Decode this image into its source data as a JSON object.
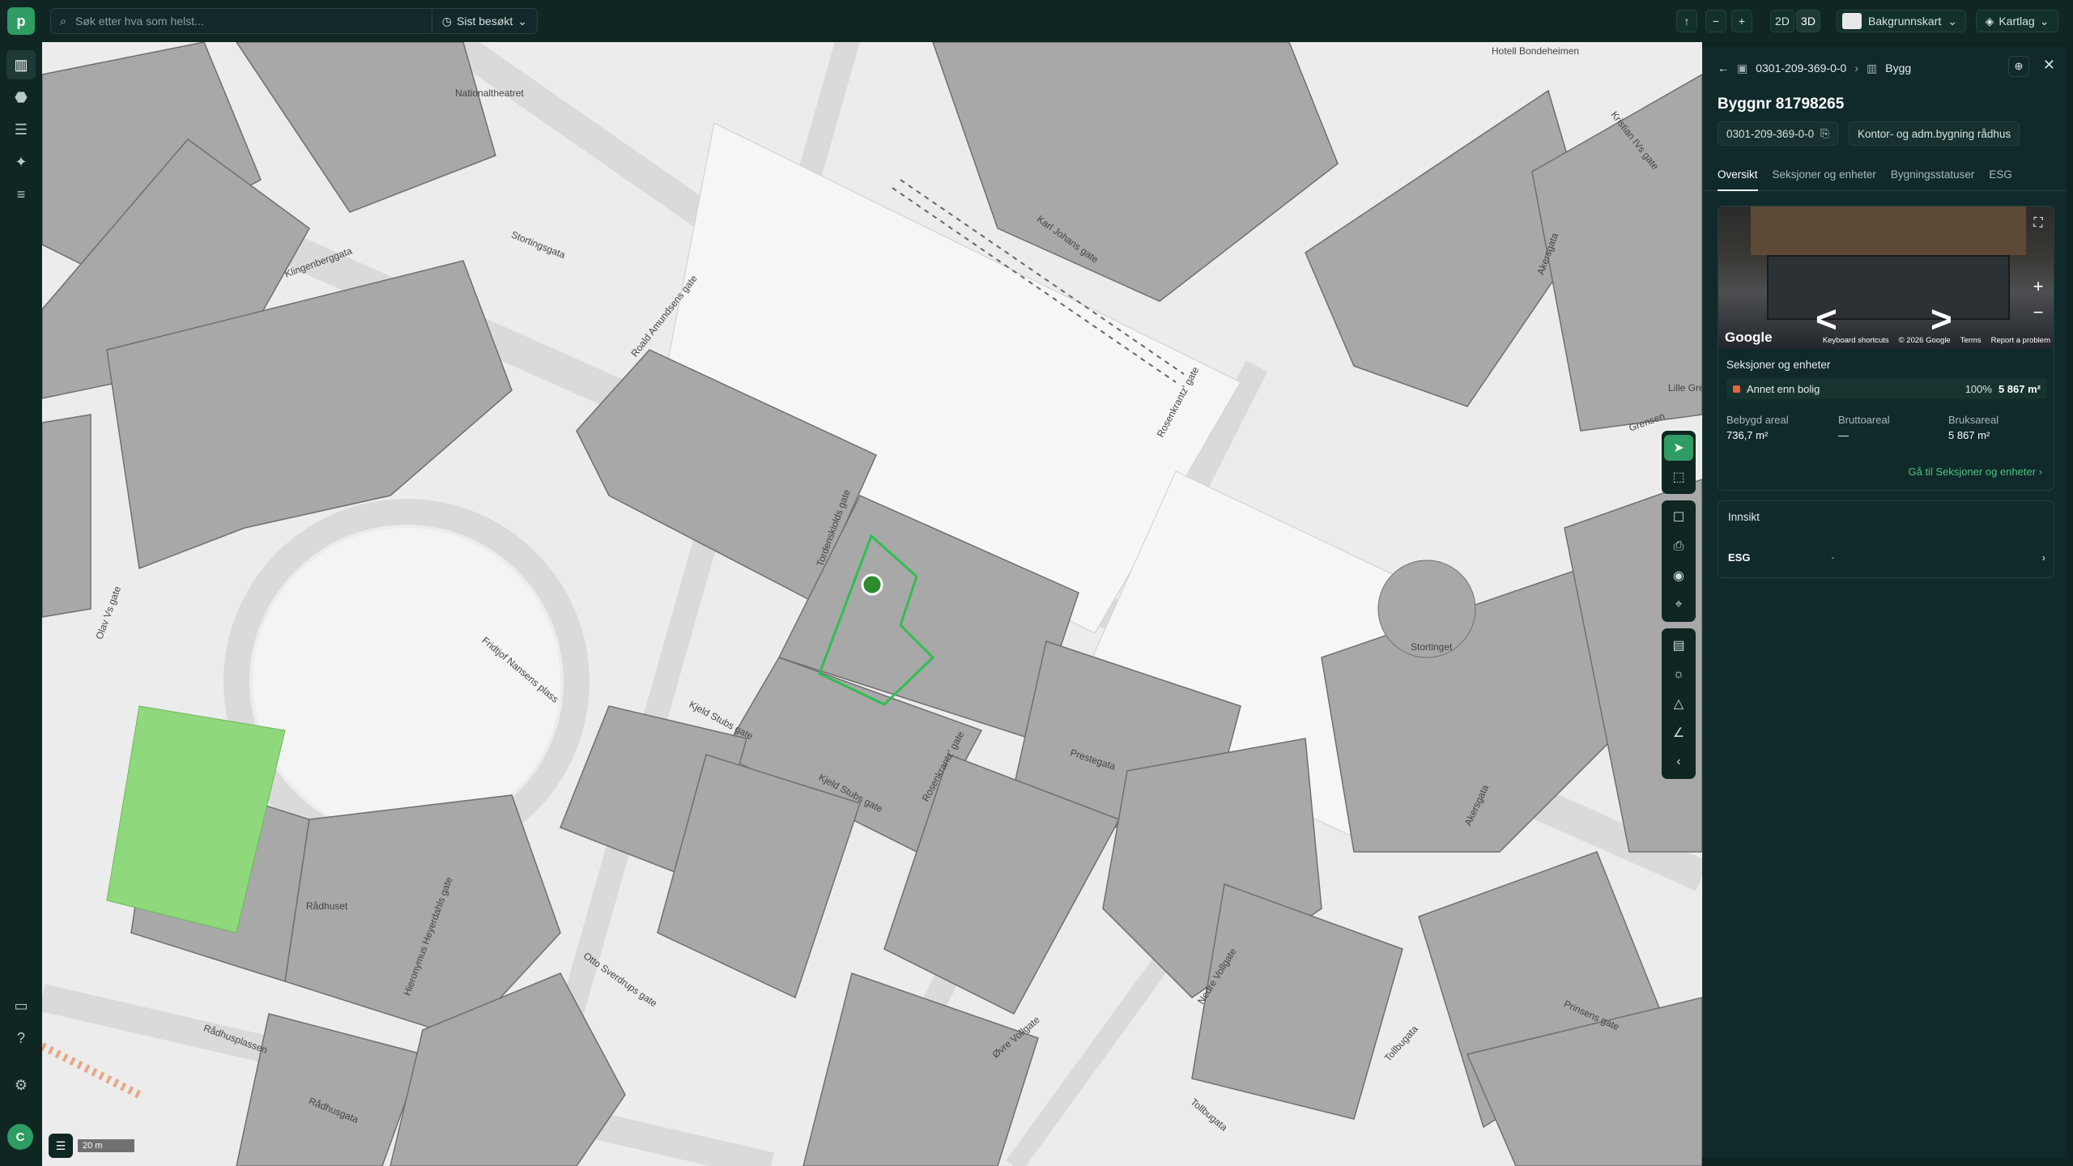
{
  "search": {
    "placeholder": "Søk etter hva som helst...",
    "recent_label": "Sist besøkt"
  },
  "toolbar": {
    "zoom_out": "−",
    "zoom_in": "+",
    "view_2d": "2D",
    "view_3d": "3D",
    "background_label": "Bakgrunnskart",
    "layers_label": "Kartlag"
  },
  "user": {
    "initial": "C"
  },
  "map": {
    "scale_label": "20 m",
    "labels": [
      "Nationaltheatret",
      "Stortingsgata",
      "Klingenberggata",
      "Roald Amundsens gate",
      "Karl Johans gate",
      "Hotell Bondeheimen",
      "Rosenkrantz' gate",
      "Tordenskiolds gate",
      "Fridtjof Nansens plass",
      "Kjeld Stubs gate",
      "Prestegata",
      "Stortinget",
      "Rådhuset",
      "Otto Sverdrups gate",
      "Rådhusplassen",
      "Hieronymus Heyerdahls gate",
      "Øvre Vollgate",
      "Nedre Vollgate",
      "Tollbugata",
      "Akersgata",
      "Olav Vs gate",
      "Lille Grensen",
      "Kristian IVs gate",
      "Akersgata",
      "Grensen",
      "Kjeld Stubs gate",
      "Rosenkrantz' gate",
      "Tollbugata",
      "Rådhusgata",
      "Prinsens gate"
    ]
  },
  "panel": {
    "breadcrumb_id": "0301-209-369-0-0",
    "breadcrumb_type": "Bygg",
    "title": "Byggnr 81798265",
    "chip_id": "0301-209-369-0-0",
    "chip_type": "Kontor- og adm.bygning rådhus",
    "tabs": [
      "Oversikt",
      "Seksjoner og enheter",
      "Bygningsstatuser",
      "ESG"
    ],
    "streetview": {
      "brand": "Google",
      "keyboard": "Keyboard shortcuts",
      "copyright": "© 2026 Google",
      "terms": "Terms",
      "report": "Report a problem"
    },
    "sections_title": "Seksjoner og enheter",
    "section_row": {
      "name": "Annet enn bolig",
      "percent": "100%",
      "area": "5 867 m²",
      "color": "#e7643c"
    },
    "stats": [
      {
        "label": "Bebygd areal",
        "value": "736,7 m²"
      },
      {
        "label": "Bruttoareal",
        "value": "—"
      },
      {
        "label": "Bruksareal",
        "value": "5 867 m²"
      }
    ],
    "goto_link": "Gå til Seksjoner og enheter",
    "insight_title": "Innsikt",
    "esg_label": "ESG",
    "esg_value": "-"
  },
  "colors": {
    "accent": "#2e9c63",
    "panel_bg": "#10292b",
    "map_bg": "#e9e9e9",
    "building": "#a6a6a6",
    "park": "#8fd97c"
  }
}
